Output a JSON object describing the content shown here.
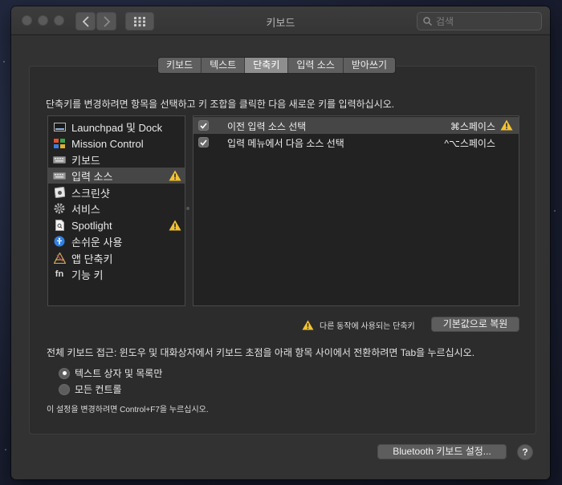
{
  "window": {
    "title": "키보드"
  },
  "search": {
    "placeholder": "검색"
  },
  "tabs": [
    {
      "label": "키보드",
      "active": false
    },
    {
      "label": "텍스트",
      "active": false
    },
    {
      "label": "단축키",
      "active": true
    },
    {
      "label": "입력 소스",
      "active": false
    },
    {
      "label": "받아쓰기",
      "active": false
    }
  ],
  "description": "단축키를 변경하려면 항목을 선택하고 키 조합을 클릭한 다음 새로운 키를 입력하십시오.",
  "categories": [
    {
      "label": "Launchpad 및 Dock",
      "icon": "launchpad-icon",
      "selected": false,
      "warning": false
    },
    {
      "label": "Mission Control",
      "icon": "mission-control-icon",
      "selected": false,
      "warning": false
    },
    {
      "label": "키보드",
      "icon": "keyboard-icon",
      "selected": false,
      "warning": false
    },
    {
      "label": "입력 소스",
      "icon": "input-source-icon",
      "selected": true,
      "warning": true
    },
    {
      "label": "스크린샷",
      "icon": "screenshot-icon",
      "selected": false,
      "warning": false
    },
    {
      "label": "서비스",
      "icon": "services-gear-icon",
      "selected": false,
      "warning": false
    },
    {
      "label": "Spotlight",
      "icon": "spotlight-document-icon",
      "selected": false,
      "warning": true
    },
    {
      "label": "손쉬운 사용",
      "icon": "accessibility-icon",
      "selected": false,
      "warning": false
    },
    {
      "label": "앱 단축키",
      "icon": "app-shortcuts-icon",
      "selected": false,
      "warning": false
    },
    {
      "label": "기능 키",
      "icon": "function-keys-icon",
      "selected": false,
      "warning": false
    }
  ],
  "shortcuts": [
    {
      "label": "이전 입력 소스 선택",
      "keys": "⌘스페이스",
      "checked": true,
      "selected": true,
      "warning": true
    },
    {
      "label": "입력 메뉴에서 다음 소스 선택",
      "keys": "^⌥스페이스",
      "checked": true,
      "selected": false,
      "warning": false
    }
  ],
  "legend": {
    "text": "다른 동작에 사용되는 단축키"
  },
  "restore_button": "기본값으로 복원",
  "full_keyboard_access": "전체 키보드 접근: 윈도우 및 대화상자에서 키보드 초점을 아래 항목 사이에서 전환하려면 Tab을 누르십시오.",
  "radio_options": [
    {
      "label": "텍스트 상자 및 목록만",
      "selected": true
    },
    {
      "label": "모든 컨트롤",
      "selected": false
    }
  ],
  "hint": "이 설정을 변경하려면 Control+F7을 누르십시오.",
  "bluetooth_button": "Bluetooth 키보드 설정...",
  "help_button": "?",
  "colors": {
    "warning": "#f2c230",
    "selected_row": "#464646",
    "window_bg": "#323232"
  }
}
